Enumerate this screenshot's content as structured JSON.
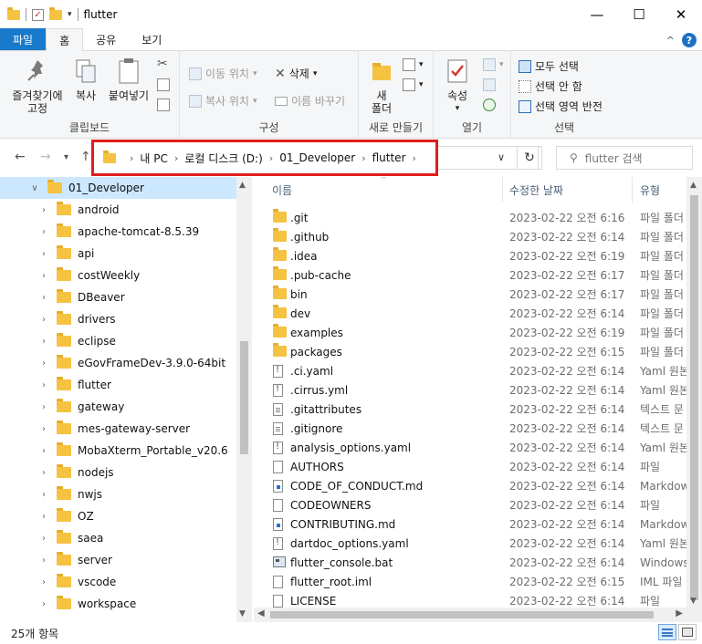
{
  "window": {
    "title": "flutter",
    "minimize": "—",
    "maximize": "☐",
    "close": "✕"
  },
  "ribbon_tabs": [
    "파일",
    "홈",
    "공유",
    "보기"
  ],
  "ribbon": {
    "clipboard": {
      "label": "클립보드",
      "pin_line1": "즐겨찾기에",
      "pin_line2": "고정",
      "copy": "복사",
      "paste": "붙여넣기"
    },
    "organize": {
      "label": "구성",
      "move_to": "이동 위치",
      "copy_to": "복사 위치",
      "delete": "삭제",
      "rename": "이름 바꾸기"
    },
    "new": {
      "label": "새로 만들기",
      "new_folder_line1": "새",
      "new_folder_line2": "폴더"
    },
    "open": {
      "label": "열기",
      "properties": "속성"
    },
    "select": {
      "label": "선택",
      "select_all": "모두 선택",
      "select_none": "선택 안 함",
      "invert": "선택 영역 반전"
    }
  },
  "address": {
    "crumbs": [
      "내 PC",
      "로컬 디스크 (D:)",
      "01_Developer",
      "flutter"
    ],
    "search_placeholder": "flutter 검색"
  },
  "nav_tree": [
    {
      "label": "01_Developer",
      "expanded": true,
      "selected": true
    },
    {
      "label": "android"
    },
    {
      "label": "apache-tomcat-8.5.39"
    },
    {
      "label": "api"
    },
    {
      "label": "costWeekly"
    },
    {
      "label": "DBeaver"
    },
    {
      "label": "drivers"
    },
    {
      "label": "eclipse"
    },
    {
      "label": "eGovFrameDev-3.9.0-64bit"
    },
    {
      "label": "flutter"
    },
    {
      "label": "gateway"
    },
    {
      "label": "mes-gateway-server"
    },
    {
      "label": "MobaXterm_Portable_v20.6"
    },
    {
      "label": "nodejs"
    },
    {
      "label": "nwjs"
    },
    {
      "label": "OZ"
    },
    {
      "label": "saea"
    },
    {
      "label": "server"
    },
    {
      "label": "vscode"
    },
    {
      "label": "workspace"
    }
  ],
  "columns": {
    "name": "이름",
    "date": "수정한 날짜",
    "type": "유형"
  },
  "files": [
    {
      "name": ".git",
      "date": "2023-02-22 오전 6:16",
      "type": "파일 폴더",
      "icon": "folder"
    },
    {
      "name": ".github",
      "date": "2023-02-22 오전 6:14",
      "type": "파일 폴더",
      "icon": "folder"
    },
    {
      "name": ".idea",
      "date": "2023-02-22 오전 6:19",
      "type": "파일 폴더",
      "icon": "folder"
    },
    {
      "name": ".pub-cache",
      "date": "2023-02-22 오전 6:17",
      "type": "파일 폴더",
      "icon": "folder"
    },
    {
      "name": "bin",
      "date": "2023-02-22 오전 6:17",
      "type": "파일 폴더",
      "icon": "folder"
    },
    {
      "name": "dev",
      "date": "2023-02-22 오전 6:14",
      "type": "파일 폴더",
      "icon": "folder"
    },
    {
      "name": "examples",
      "date": "2023-02-22 오전 6:19",
      "type": "파일 폴더",
      "icon": "folder"
    },
    {
      "name": "packages",
      "date": "2023-02-22 오전 6:15",
      "type": "파일 폴더",
      "icon": "folder"
    },
    {
      "name": ".ci.yaml",
      "date": "2023-02-22 오전 6:14",
      "type": "Yaml 원본",
      "icon": "yaml"
    },
    {
      "name": ".cirrus.yml",
      "date": "2023-02-22 오전 6:14",
      "type": "Yaml 원본",
      "icon": "yaml"
    },
    {
      "name": ".gitattributes",
      "date": "2023-02-22 오전 6:14",
      "type": "텍스트 문",
      "icon": "file"
    },
    {
      "name": ".gitignore",
      "date": "2023-02-22 오전 6:14",
      "type": "텍스트 문",
      "icon": "file"
    },
    {
      "name": "analysis_options.yaml",
      "date": "2023-02-22 오전 6:14",
      "type": "Yaml 원본",
      "icon": "yaml"
    },
    {
      "name": "AUTHORS",
      "date": "2023-02-22 오전 6:14",
      "type": "파일",
      "icon": "plain"
    },
    {
      "name": "CODE_OF_CONDUCT.md",
      "date": "2023-02-22 오전 6:14",
      "type": "Markdow",
      "icon": "md"
    },
    {
      "name": "CODEOWNERS",
      "date": "2023-02-22 오전 6:14",
      "type": "파일",
      "icon": "plain"
    },
    {
      "name": "CONTRIBUTING.md",
      "date": "2023-02-22 오전 6:14",
      "type": "Markdow",
      "icon": "md"
    },
    {
      "name": "dartdoc_options.yaml",
      "date": "2023-02-22 오전 6:14",
      "type": "Yaml 원본",
      "icon": "yaml"
    },
    {
      "name": "flutter_console.bat",
      "date": "2023-02-22 오전 6:14",
      "type": "Windows",
      "icon": "bat"
    },
    {
      "name": "flutter_root.iml",
      "date": "2023-02-22 오전 6:15",
      "type": "IML 파일",
      "icon": "plain"
    },
    {
      "name": "LICENSE",
      "date": "2023-02-22 오전 6:14",
      "type": "파일",
      "icon": "plain"
    }
  ],
  "status": {
    "item_count": "25개 항목"
  }
}
